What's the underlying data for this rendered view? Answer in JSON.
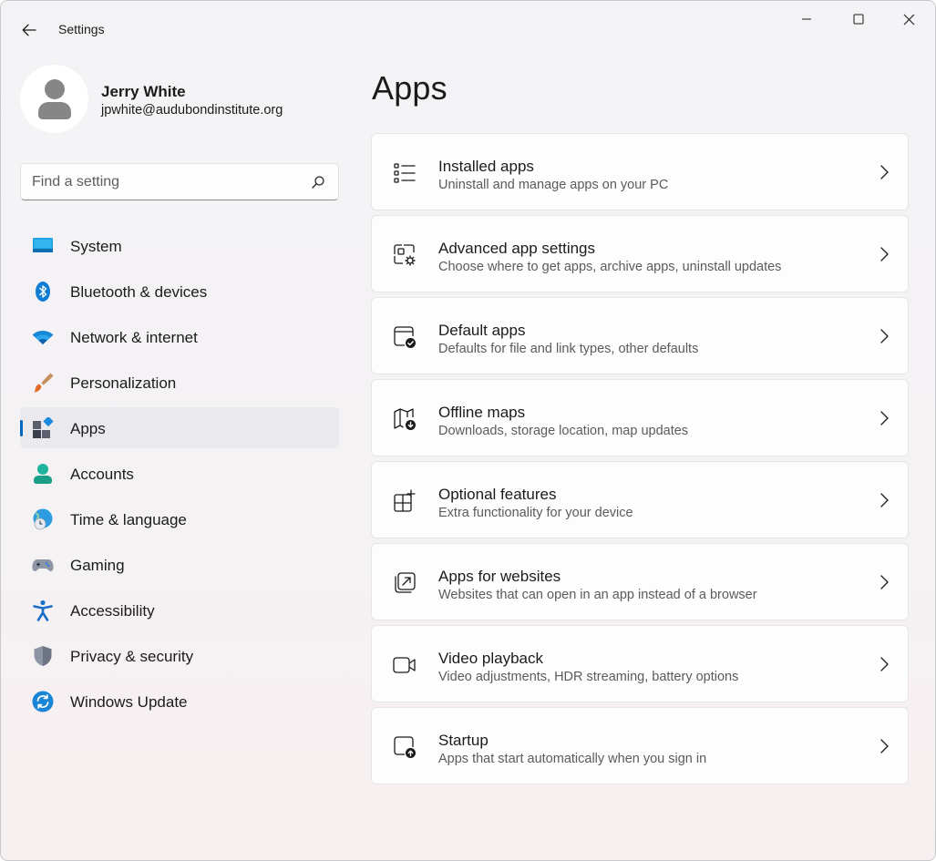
{
  "window": {
    "title": "Settings"
  },
  "profile": {
    "name": "Jerry White",
    "email": "jpwhite@audubondinstitute.org"
  },
  "search": {
    "placeholder": "Find a setting"
  },
  "nav": {
    "items": [
      {
        "label": "System",
        "icon": "system-icon"
      },
      {
        "label": "Bluetooth & devices",
        "icon": "bluetooth-icon"
      },
      {
        "label": "Network & internet",
        "icon": "wifi-icon"
      },
      {
        "label": "Personalization",
        "icon": "brush-icon"
      },
      {
        "label": "Apps",
        "icon": "apps-icon",
        "selected": true
      },
      {
        "label": "Accounts",
        "icon": "person-icon"
      },
      {
        "label": "Time & language",
        "icon": "globe-clock-icon"
      },
      {
        "label": "Gaming",
        "icon": "gamepad-icon"
      },
      {
        "label": "Accessibility",
        "icon": "accessibility-icon"
      },
      {
        "label": "Privacy & security",
        "icon": "shield-icon"
      },
      {
        "label": "Windows Update",
        "icon": "update-icon"
      }
    ]
  },
  "main": {
    "title": "Apps",
    "cards": [
      {
        "title": "Installed apps",
        "subtitle": "Uninstall and manage apps on your PC",
        "icon": "list-icon"
      },
      {
        "title": "Advanced app settings",
        "subtitle": "Choose where to get apps, archive apps, uninstall updates",
        "icon": "app-gear-icon"
      },
      {
        "title": "Default apps",
        "subtitle": "Defaults for file and link types, other defaults",
        "icon": "window-check-icon"
      },
      {
        "title": "Offline maps",
        "subtitle": "Downloads, storage location, map updates",
        "icon": "map-download-icon"
      },
      {
        "title": "Optional features",
        "subtitle": "Extra functionality for your device",
        "icon": "grid-add-icon"
      },
      {
        "title": "Apps for websites",
        "subtitle": "Websites that can open in an app instead of a browser",
        "icon": "open-link-icon"
      },
      {
        "title": "Video playback",
        "subtitle": "Video adjustments, HDR streaming, battery options",
        "icon": "video-camera-icon"
      },
      {
        "title": "Startup",
        "subtitle": "Apps that start automatically when you sign in",
        "icon": "startup-icon"
      }
    ]
  },
  "colors": {
    "accent": "#0067c0",
    "selected_bg": "#eaeaee",
    "card_bg": "#fdfdfd"
  }
}
